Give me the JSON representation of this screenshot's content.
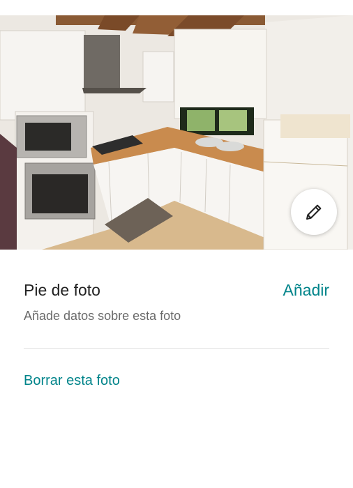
{
  "photo": {
    "alt_icon": "kitchen-photo"
  },
  "edit_button": {
    "icon": "pencil-icon"
  },
  "caption": {
    "title": "Pie de foto",
    "add_label": "Añadir",
    "subtitle": "Añade datos sobre esta foto"
  },
  "actions": {
    "delete_label": "Borrar esta foto"
  },
  "colors": {
    "accent": "#00848a",
    "text": "#222222",
    "muted": "#6a6a6a",
    "divider": "#e2e2e2"
  }
}
